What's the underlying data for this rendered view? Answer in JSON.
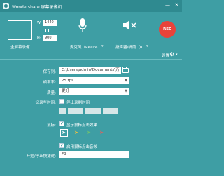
{
  "titlebar": {
    "title": "Wondershare 屏幕录像机",
    "minimize": "—",
    "close": "✕"
  },
  "capture": {
    "mode_label": "全屏幕录像",
    "mode_arrow": "▾",
    "width_label": "W:",
    "width_value": "1440",
    "height_label": "H:",
    "height_value": "900"
  },
  "microphone": {
    "label": "麦克风（Realte...",
    "arrow": "▾"
  },
  "speaker": {
    "label": "扬声器/听筒（R...",
    "arrow": "▾"
  },
  "record_button": "REC",
  "settings": {
    "label": "设置",
    "arrow": "▾"
  },
  "form": {
    "save_to_label": "保存到:",
    "save_to_value": "C:\\Users\\admin\\Documents\\万",
    "frame_rate_label": "帧率率:",
    "frame_rate_value": "25 fps",
    "quality_label": "质量:",
    "quality_value": "更好",
    "record_duration_label": "记录些时间:",
    "stop_at_label": "停止录制时间",
    "time_value": "",
    "mouse_label": "鼠标:",
    "show_cursor_label": "显示鼠标点击效果",
    "enable_shortcut_label": "启用鼠标点击音效",
    "hotkey_label": "开始/停止快捷键:",
    "hotkey_value": "F9"
  },
  "colors": {
    "background": "#3e9ea4",
    "titlebar": "#2f8a90",
    "record": "#e8433a"
  }
}
